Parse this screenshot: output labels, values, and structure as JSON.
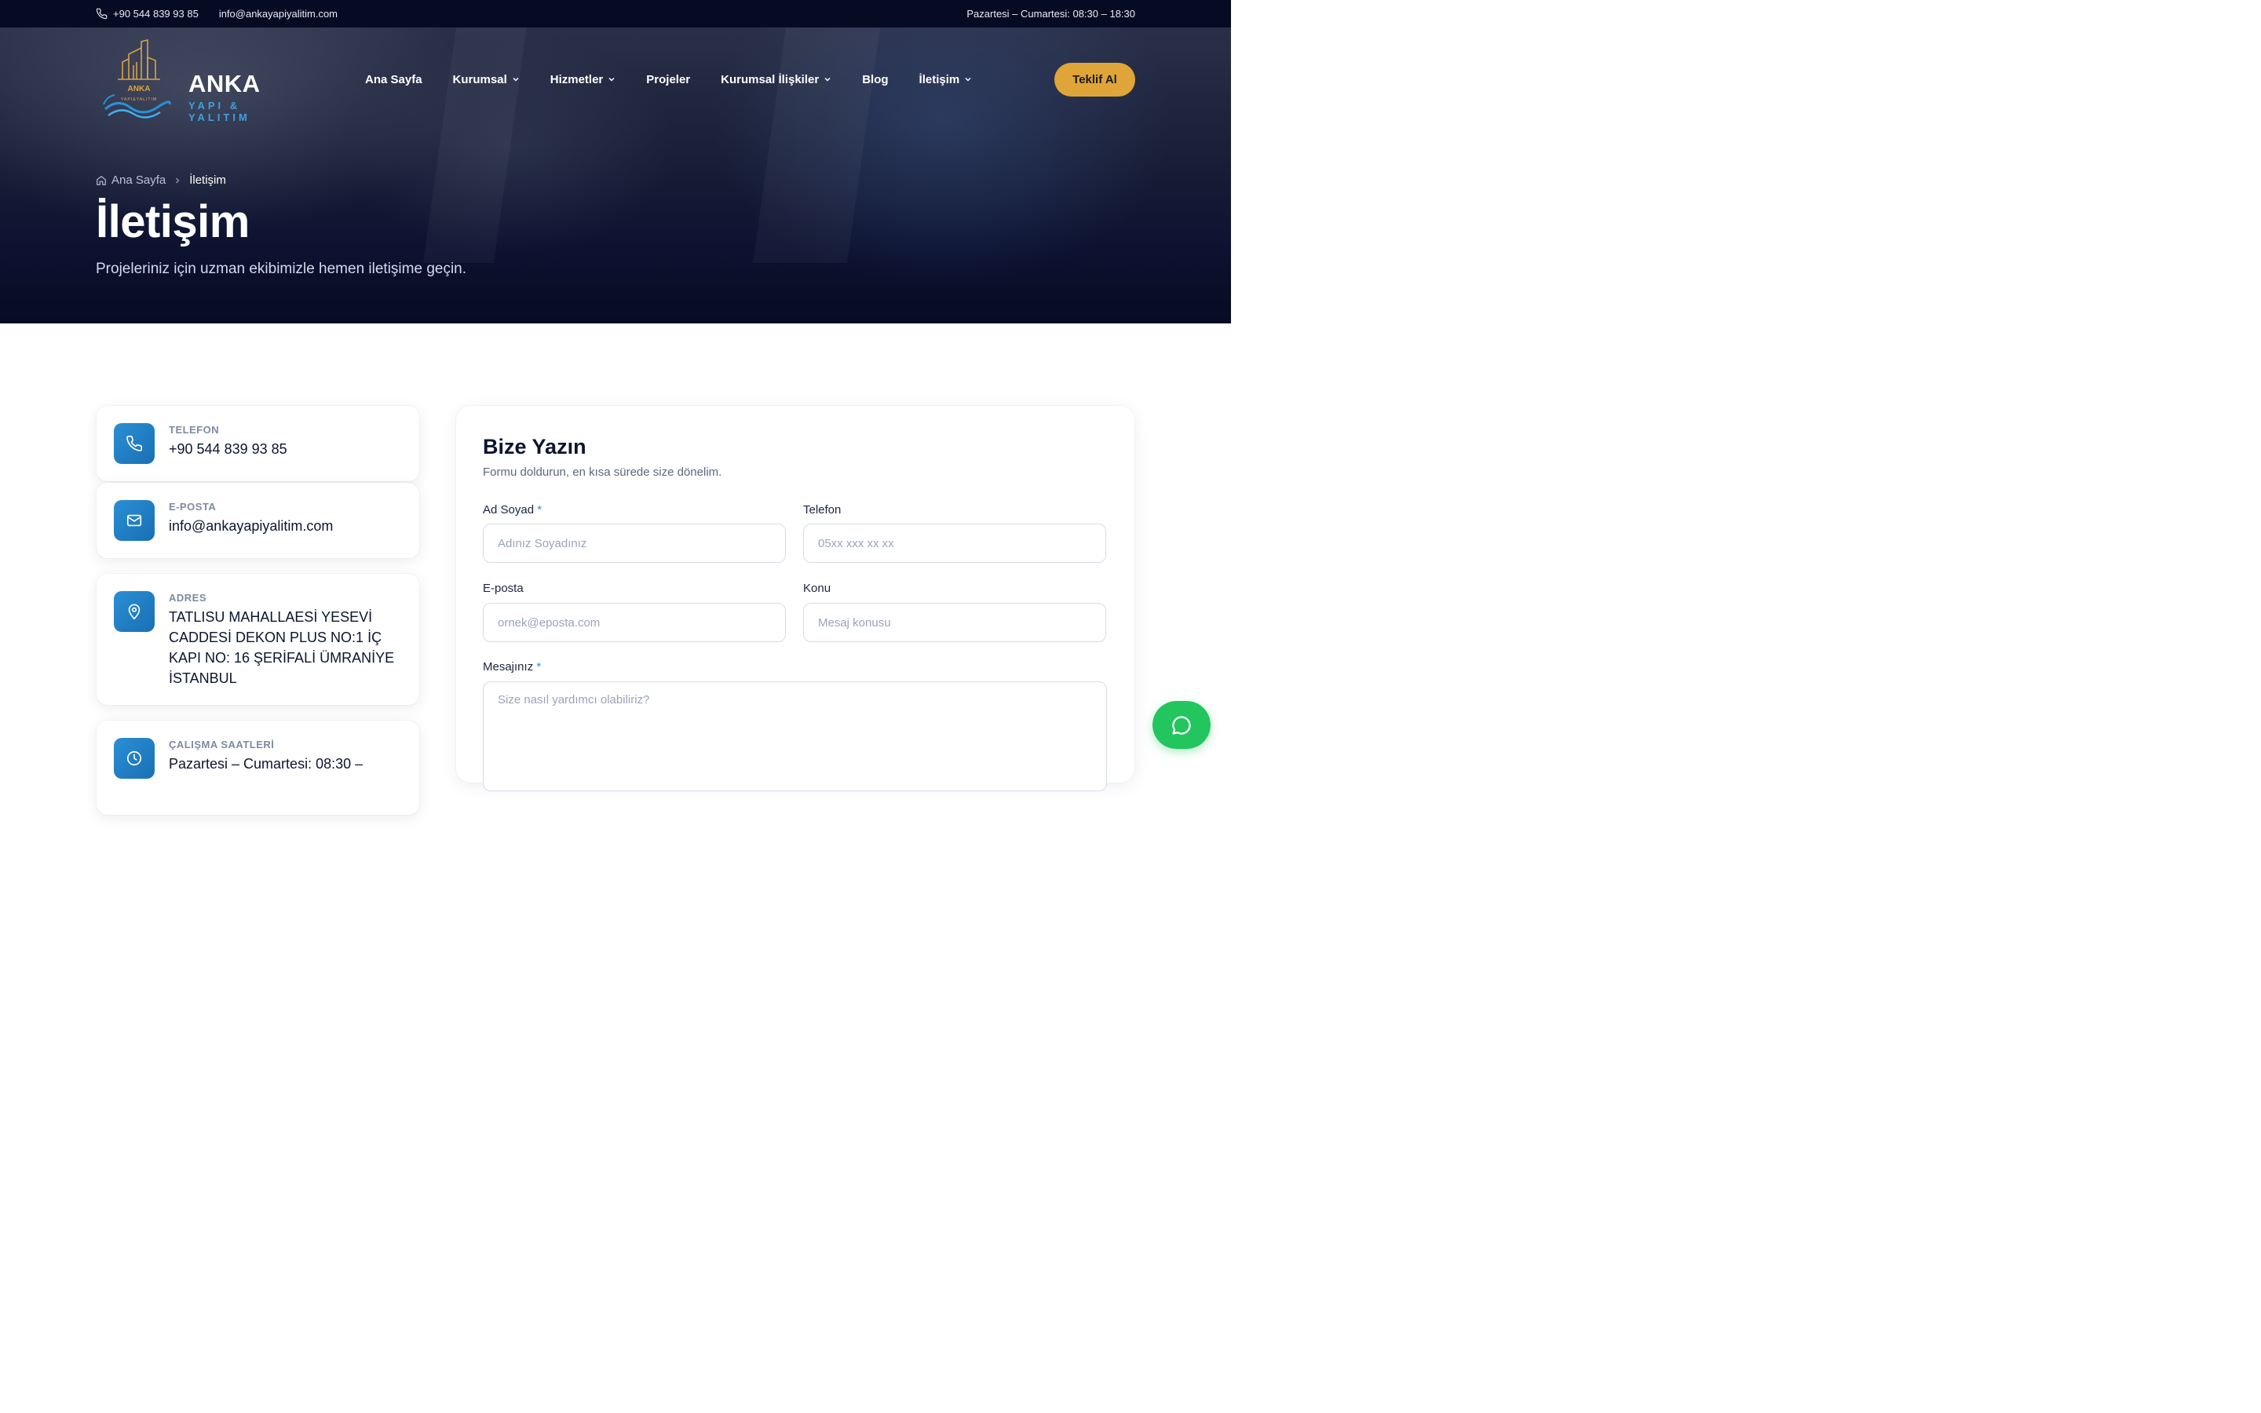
{
  "topbar": {
    "phone": "+90 544 839 93 85",
    "email": "info@ankayapiyalitim.com",
    "hours": "Pazartesi – Cumartesi: 08:30 – 18:30"
  },
  "logo": {
    "mark_text": "ANKA",
    "mark_sub": "YAPI&YALITIM",
    "name": "ANKA",
    "sub": "YAPI & YALITIM"
  },
  "nav": {
    "items": [
      {
        "label": "Ana Sayfa",
        "has_dropdown": false
      },
      {
        "label": "Kurumsal",
        "has_dropdown": true
      },
      {
        "label": "Hizmetler",
        "has_dropdown": true
      },
      {
        "label": "Projeler",
        "has_dropdown": false
      },
      {
        "label": "Kurumsal İlişkiler",
        "has_dropdown": true
      },
      {
        "label": "Blog",
        "has_dropdown": false
      },
      {
        "label": "İletişim",
        "has_dropdown": true
      }
    ],
    "cta_label": "Teklif Al"
  },
  "hero": {
    "breadcrumb_home": "Ana Sayfa",
    "breadcrumb_current": "İletişim",
    "title": "İletişim",
    "subtitle": "Projeleriniz için uzman ekibimizle hemen iletişime geçin."
  },
  "contact": {
    "phone": {
      "label": "TELEFON",
      "value": "+90 544 839 93 85"
    },
    "email": {
      "label": "E-POSTA",
      "value": "info@ankayapiyalitim.com"
    },
    "address": {
      "label": "ADRES",
      "value": "TATLISU MAHALLAESİ YESEVİ CADDESİ DEKON PLUS NO:1 İÇ KAPI NO: 16 ŞERİFALİ ÜMRANİYE İSTANBUL"
    },
    "hours": {
      "label": "ÇALIŞMA SAATLERİ",
      "value": "Pazartesi – Cumartesi: 08:30 –"
    }
  },
  "form": {
    "title": "Bize Yazın",
    "subtitle": "Formu doldurun, en kısa sürede size dönelim.",
    "name_label": "Ad Soyad",
    "name_placeholder": "Adınız Soyadınız",
    "phone_label": "Telefon",
    "phone_placeholder": "05xx xxx xx xx",
    "email_label": "E-posta",
    "email_placeholder": "ornek@eposta.com",
    "subject_label": "Konu",
    "subject_placeholder": "Mesaj konusu",
    "message_label": "Mesajınız",
    "message_placeholder": "Size nasıl yardımcı olabiliriz?",
    "required_mark": "*"
  },
  "colors": {
    "topbar_bg": "#060b24",
    "accent": "#e0a538",
    "brand_blue": "#2a8fd6",
    "whatsapp": "#22c55e"
  },
  "icons": {
    "phone": "phone-icon",
    "email": "mail-icon",
    "address": "map-pin-icon",
    "hours": "clock-icon",
    "chat": "whatsapp-icon"
  }
}
